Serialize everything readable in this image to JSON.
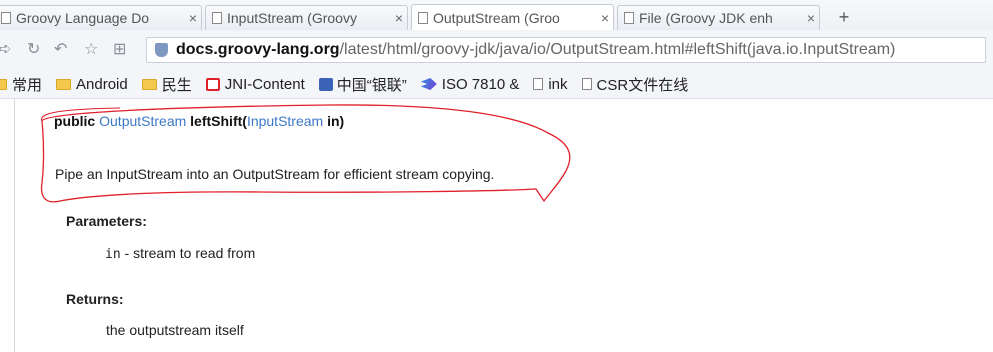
{
  "tabs": [
    {
      "title": "Groovy Language Do",
      "close": "×"
    },
    {
      "title": "InputStream (Groovy",
      "close": "×"
    },
    {
      "title": "OutputStream (Groo",
      "close": "×"
    },
    {
      "title": "File (Groovy JDK enh",
      "close": "×"
    }
  ],
  "new_tab": "+",
  "address": {
    "host": "docs.groovy-lang.org",
    "path": "/latest/html/groovy-jdk/java/io/OutputStream.html#leftShift(java.io.InputStream)"
  },
  "bookmarks": [
    {
      "label": "常用",
      "icon": "folder-icon"
    },
    {
      "label": "Android",
      "icon": "folder-icon"
    },
    {
      "label": "民生",
      "icon": "folder-icon"
    },
    {
      "label": "JNI-Content",
      "icon": "red-box-icon"
    },
    {
      "label": "中国“银联”",
      "icon": "picture-icon"
    },
    {
      "label": "ISO 7810 &",
      "icon": "arrow-logo-icon"
    },
    {
      "label": "ink",
      "icon": "page-icon"
    },
    {
      "label": "CSR文件在线",
      "icon": "page-icon"
    }
  ],
  "doc": {
    "sig_public": "public",
    "sig_type": "OutputStream",
    "sig_method": "leftShift(",
    "sig_param_type": "InputStream",
    "sig_param_name": " in)",
    "description": "Pipe an InputStream into an OutputStream for efficient stream copying.",
    "params_heading": "Parameters:",
    "param_name": "in",
    "param_desc": " - stream to read from",
    "returns_heading": "Returns:",
    "returns_desc": "the outputstream itself"
  },
  "colors": {
    "link": "#3d78c5",
    "annotation": "#e0202a"
  }
}
